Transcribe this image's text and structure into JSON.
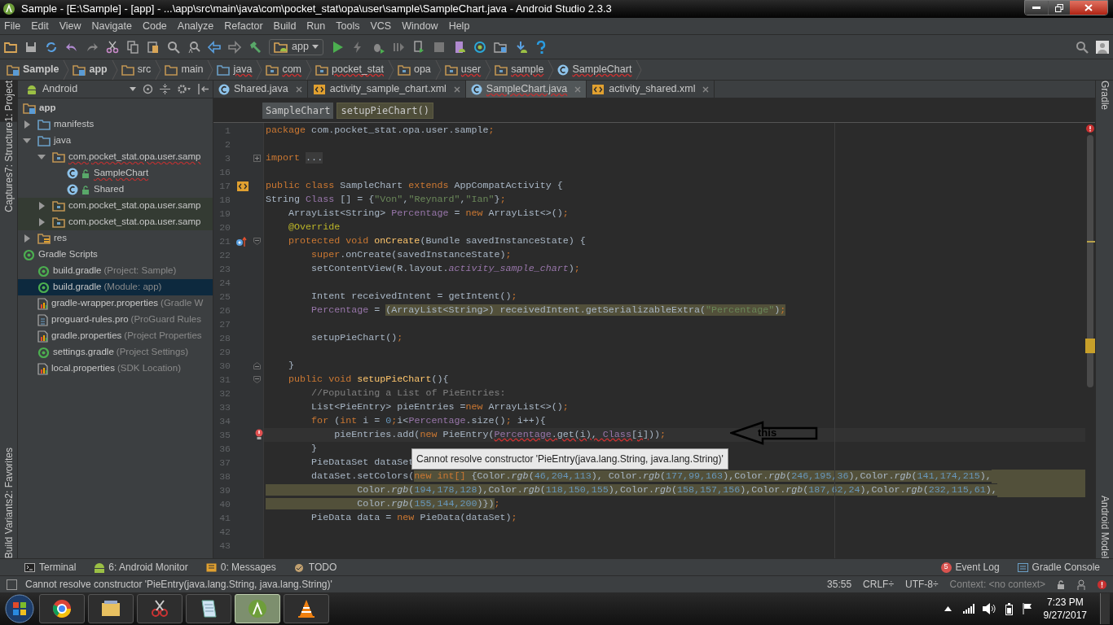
{
  "window": {
    "title": "Sample - [E:\\Sample] - [app] - ...\\app\\src\\main\\java\\com\\pocket_stat\\opa\\user\\sample\\SampleChart.java - Android Studio 2.3.3"
  },
  "menu": [
    "File",
    "Edit",
    "View",
    "Navigate",
    "Code",
    "Analyze",
    "Refactor",
    "Build",
    "Run",
    "Tools",
    "VCS",
    "Window",
    "Help"
  ],
  "run_config": "app",
  "breadcrumbs": [
    {
      "label": "Sample",
      "kind": "module",
      "bold": true,
      "error": false
    },
    {
      "label": "app",
      "kind": "module",
      "bold": true,
      "error": false
    },
    {
      "label": "src",
      "kind": "folder",
      "bold": false,
      "error": false
    },
    {
      "label": "main",
      "kind": "folder",
      "bold": false,
      "error": false
    },
    {
      "label": "java",
      "kind": "source",
      "bold": false,
      "error": true
    },
    {
      "label": "com",
      "kind": "package",
      "bold": false,
      "error": true
    },
    {
      "label": "pocket_stat",
      "kind": "package",
      "bold": false,
      "error": true
    },
    {
      "label": "opa",
      "kind": "package",
      "bold": false,
      "error": false
    },
    {
      "label": "user",
      "kind": "package",
      "bold": false,
      "error": true
    },
    {
      "label": "sample",
      "kind": "package",
      "bold": false,
      "error": true
    },
    {
      "label": "SampleChart",
      "kind": "class",
      "bold": false,
      "error": true
    }
  ],
  "left_strip": {
    "top": [
      {
        "label": "1: Project",
        "selected": true
      },
      {
        "label": "7: Structure",
        "selected": false
      },
      {
        "label": "Captures",
        "selected": false
      }
    ],
    "bottom": [
      {
        "label": "2: Favorites",
        "selected": false
      },
      {
        "label": "Build Variants",
        "selected": false
      }
    ]
  },
  "right_strip": {
    "top": [
      {
        "label": "Gradle"
      }
    ],
    "bottom": [
      {
        "label": "Android Model"
      }
    ]
  },
  "project": {
    "view": "Android",
    "tree": [
      {
        "label": "app",
        "kind": "module",
        "children": [
          {
            "label": "manifests",
            "kind": "source",
            "expanded": false
          },
          {
            "label": "java",
            "kind": "source",
            "expanded": true,
            "children": [
              {
                "label": "com.pocket_stat.opa.user.samp",
                "kind": "package",
                "expanded": true,
                "error": true,
                "children": [
                  {
                    "label": "SampleChart",
                    "kind": "class",
                    "error": true
                  },
                  {
                    "label": "Shared",
                    "kind": "class",
                    "error": false
                  }
                ]
              },
              {
                "label": "com.pocket_stat.opa.user.samp",
                "kind": "package",
                "expanded": false,
                "tinted": true
              },
              {
                "label": "com.pocket_stat.opa.user.samp",
                "kind": "package",
                "expanded": false,
                "tinted": true
              }
            ]
          },
          {
            "label": "res",
            "kind": "res",
            "expanded": false
          }
        ]
      },
      {
        "label": "Gradle Scripts",
        "kind": "gradle",
        "children": [
          {
            "label": "build.gradle",
            "note": "(Project: Sample)",
            "kind": "gradle",
            "selected": false
          },
          {
            "label": "build.gradle",
            "note": "(Module: app)",
            "kind": "gradle",
            "selected": true
          },
          {
            "label": "gradle-wrapper.properties",
            "note": "(Gradle W",
            "kind": "props",
            "selected": false
          },
          {
            "label": "proguard-rules.pro",
            "note": "(ProGuard Rules",
            "kind": "file",
            "selected": false
          },
          {
            "label": "gradle.properties",
            "note": "(Project Properties",
            "kind": "props",
            "selected": false
          },
          {
            "label": "settings.gradle",
            "note": "(Project Settings)",
            "kind": "gradle",
            "selected": false
          },
          {
            "label": "local.properties",
            "note": "(SDK Location)",
            "kind": "props",
            "selected": false
          }
        ]
      }
    ]
  },
  "tabs": [
    {
      "label": "Shared.java",
      "kind": "class",
      "selected": false,
      "error": false
    },
    {
      "label": "activity_sample_chart.xml",
      "kind": "xml",
      "selected": false,
      "error": false
    },
    {
      "label": "SampleChart.java",
      "kind": "class",
      "selected": true,
      "error": true
    },
    {
      "label": "activity_shared.xml",
      "kind": "xml",
      "selected": false,
      "error": false
    }
  ],
  "editor_breadcrumbs": [
    {
      "label": "SampleChart",
      "selected": false
    },
    {
      "label": "setupPieChart()",
      "selected": true
    }
  ],
  "code": [
    {
      "number": "1",
      "tokens": [
        {
          "kind": "kw",
          "text": "package"
        },
        {
          "kind": "plain",
          "text": " com.pocket_stat.opa.user.sample"
        },
        {
          "kind": "kw",
          "text": ";"
        }
      ]
    },
    {
      "number": "2"
    },
    {
      "number": "3",
      "gutter": [
        {
          "kind": "fold_plus"
        }
      ],
      "tokens": [
        {
          "kind": "kw",
          "text": "import "
        },
        {
          "kind": "folded",
          "text": "..."
        }
      ]
    },
    {
      "number": "16"
    },
    {
      "number": "17",
      "gutter": [
        {
          "kind": "layout"
        }
      ],
      "tokens": [
        {
          "kind": "kw",
          "text": "public class"
        },
        {
          "kind": "plain",
          "text": " SampleChart "
        },
        {
          "kind": "kw",
          "text": "extends"
        },
        {
          "kind": "plain",
          "text": " AppCompatActivity {"
        }
      ]
    },
    {
      "number": "18",
      "tokens": [
        {
          "kind": "plain",
          "text": "String "
        },
        {
          "kind": "field",
          "text": "Class"
        },
        {
          "kind": "plain",
          "text": " [] = {"
        },
        {
          "kind": "str",
          "text": "\"Von\""
        },
        {
          "kind": "plain",
          "text": ","
        },
        {
          "kind": "str",
          "text": "\"Reynard\""
        },
        {
          "kind": "plain",
          "text": ","
        },
        {
          "kind": "str",
          "text": "\"Ian\""
        },
        {
          "kind": "plain",
          "text": "}"
        },
        {
          "kind": "kw",
          "text": ";"
        }
      ]
    },
    {
      "number": "19",
      "tokens": [
        {
          "kind": "plain",
          "text": "    ArrayList<String> "
        },
        {
          "kind": "field",
          "text": "Percentage"
        },
        {
          "kind": "plain",
          "text": " = "
        },
        {
          "kind": "kw",
          "text": "new"
        },
        {
          "kind": "plain",
          "text": " ArrayList<>()"
        },
        {
          "kind": "kw",
          "text": ";"
        }
      ]
    },
    {
      "number": "20",
      "tokens": [
        {
          "kind": "ann",
          "text": "    @Override"
        }
      ]
    },
    {
      "number": "21",
      "gutter": [
        {
          "kind": "override"
        },
        {
          "kind": "fold_start"
        }
      ],
      "tokens": [
        {
          "kind": "kw",
          "text": "    protected void "
        },
        {
          "kind": "method",
          "text": "onCreate"
        },
        {
          "kind": "plain",
          "text": "(Bundle savedInstanceState) {"
        }
      ]
    },
    {
      "number": "22",
      "tokens": [
        {
          "kind": "kw",
          "text": "        super"
        },
        {
          "kind": "plain",
          "text": ".onCreate(savedInstanceState)"
        },
        {
          "kind": "kw",
          "text": ";"
        }
      ]
    },
    {
      "number": "23",
      "tokens": [
        {
          "kind": "plain",
          "text": "        setContentView(R.layout."
        },
        {
          "kind": "field_italic",
          "text": "activity_sample_chart"
        },
        {
          "kind": "plain",
          "text": ")"
        },
        {
          "kind": "kw",
          "text": ";"
        }
      ]
    },
    {
      "number": "24"
    },
    {
      "number": "25",
      "tokens": [
        {
          "kind": "plain",
          "text": "        Intent receivedIntent = getIntent()"
        },
        {
          "kind": "kw",
          "text": ";"
        }
      ]
    },
    {
      "number": "26",
      "tokens": [
        {
          "kind": "field",
          "text": "        Percentage"
        },
        {
          "kind": "plain",
          "text": " = "
        },
        {
          "kind": "plain",
          "text": "(ArrayList<String>) receivedIntent.getSerializableExtra(",
          "highlighted": true
        },
        {
          "kind": "str",
          "text": "\"Percentage\"",
          "highlighted": true
        },
        {
          "kind": "plain",
          "text": ")",
          "highlighted": true
        },
        {
          "kind": "kw",
          "text": ";",
          "highlighted": true
        }
      ]
    },
    {
      "number": "27"
    },
    {
      "number": "28",
      "tokens": [
        {
          "kind": "plain",
          "text": "        setupPieChart()"
        },
        {
          "kind": "kw",
          "text": ";"
        }
      ]
    },
    {
      "number": "29"
    },
    {
      "number": "30",
      "gutter": [
        {
          "kind": "fold_end"
        }
      ],
      "tokens": [
        {
          "kind": "plain",
          "text": "    }"
        }
      ]
    },
    {
      "number": "31",
      "gutter": [
        {
          "kind": "fold_start"
        }
      ],
      "tokens": [
        {
          "kind": "kw",
          "text": "    public void "
        },
        {
          "kind": "method",
          "text": "setupPieChart"
        },
        {
          "kind": "plain",
          "text": "(){"
        }
      ]
    },
    {
      "number": "32",
      "tokens": [
        {
          "kind": "comment",
          "text": "        //Populating a List of PieEntries:"
        }
      ]
    },
    {
      "number": "33",
      "tokens": [
        {
          "kind": "plain",
          "text": "        List<PieEntry> pieEntries ="
        },
        {
          "kind": "kw",
          "text": "new"
        },
        {
          "kind": "plain",
          "text": " ArrayList<>()"
        },
        {
          "kind": "kw",
          "text": ";"
        }
      ]
    },
    {
      "number": "34",
      "tokens": [
        {
          "kind": "kw",
          "text": "        for"
        },
        {
          "kind": "plain",
          "text": " ("
        },
        {
          "kind": "kw",
          "text": "int"
        },
        {
          "kind": "plain",
          "text": " i = "
        },
        {
          "kind": "num",
          "text": "0"
        },
        {
          "kind": "kw",
          "text": ";"
        },
        {
          "kind": "plain",
          "text": "i<"
        },
        {
          "kind": "field",
          "text": "Percentage"
        },
        {
          "kind": "plain",
          "text": ".size()"
        },
        {
          "kind": "kw",
          "text": ";"
        },
        {
          "kind": "plain",
          "text": " i++){"
        }
      ]
    },
    {
      "number": "35",
      "current": true,
      "gutter": [
        {
          "kind": "error"
        }
      ],
      "tokens": [
        {
          "kind": "plain",
          "text": "            pieEntries.add("
        },
        {
          "kind": "kw",
          "text": "new"
        },
        {
          "kind": "plain",
          "text": " PieEntry("
        },
        {
          "kind": "field",
          "text": "Percentage",
          "error": true
        },
        {
          "kind": "plain",
          "text": ".get(i), ",
          "error": true
        },
        {
          "kind": "field",
          "text": "Class",
          "error": true
        },
        {
          "kind": "plain",
          "text": "[i]",
          "error": true
        },
        {
          "kind": "plain",
          "text": "))"
        },
        {
          "kind": "kw",
          "text": ";"
        }
      ]
    },
    {
      "number": "36",
      "tokens": [
        {
          "kind": "plain",
          "text": "        }"
        }
      ]
    },
    {
      "number": "37",
      "tokens": [
        {
          "kind": "plain",
          "text": "        PieDataSet dataSet"
        }
      ]
    },
    {
      "number": "38",
      "fill_rest": true,
      "tokens": [
        {
          "kind": "plain",
          "text": "        dataSet.setColors("
        },
        {
          "kind": "kw",
          "text": "new int[]",
          "highlighted": true
        },
        {
          "kind": "plain",
          "text": " {Color.",
          "highlighted": true
        },
        {
          "kind": "static",
          "text": "rgb",
          "highlighted": true
        },
        {
          "kind": "plain",
          "text": "(",
          "highlighted": true
        },
        {
          "kind": "num",
          "text": "46,204,113",
          "highlighted": true
        },
        {
          "kind": "plain",
          "text": "), Color.",
          "highlighted": true
        },
        {
          "kind": "static",
          "text": "rgb",
          "highlighted": true
        },
        {
          "kind": "plain",
          "text": "(",
          "highlighted": true
        },
        {
          "kind": "num",
          "text": "177,99,163",
          "highlighted": true
        },
        {
          "kind": "plain",
          "text": "),Color.",
          "highlighted": true
        },
        {
          "kind": "static",
          "text": "rgb",
          "highlighted": true
        },
        {
          "kind": "plain",
          "text": "(",
          "highlighted": true
        },
        {
          "kind": "num",
          "text": "246,195,36",
          "highlighted": true
        },
        {
          "kind": "plain",
          "text": "),Color.",
          "highlighted": true
        },
        {
          "kind": "static",
          "text": "rgb",
          "highlighted": true
        },
        {
          "kind": "plain",
          "text": "(",
          "highlighted": true
        },
        {
          "kind": "num",
          "text": "141,174,215",
          "highlighted": true
        },
        {
          "kind": "plain",
          "text": "),",
          "highlighted": true
        }
      ]
    },
    {
      "number": "39",
      "fill_rest": true,
      "tokens": [
        {
          "kind": "plain",
          "text": "                Color.",
          "highlighted": true
        },
        {
          "kind": "static",
          "text": "rgb",
          "highlighted": true
        },
        {
          "kind": "plain",
          "text": "(",
          "highlighted": true
        },
        {
          "kind": "num",
          "text": "194,178,128",
          "highlighted": true
        },
        {
          "kind": "plain",
          "text": "),Color.",
          "highlighted": true
        },
        {
          "kind": "static",
          "text": "rgb",
          "highlighted": true
        },
        {
          "kind": "plain",
          "text": "(",
          "highlighted": true
        },
        {
          "kind": "num",
          "text": "118,150,155",
          "highlighted": true
        },
        {
          "kind": "plain",
          "text": "),Color.",
          "highlighted": true
        },
        {
          "kind": "static",
          "text": "rgb",
          "highlighted": true
        },
        {
          "kind": "plain",
          "text": "(",
          "highlighted": true
        },
        {
          "kind": "num",
          "text": "158,157,156",
          "highlighted": true
        },
        {
          "kind": "plain",
          "text": "),Color.",
          "highlighted": true
        },
        {
          "kind": "static",
          "text": "rgb",
          "highlighted": true
        },
        {
          "kind": "plain",
          "text": "(",
          "highlighted": true
        },
        {
          "kind": "num",
          "text": "187,62,24",
          "highlighted": true
        },
        {
          "kind": "plain",
          "text": "),Color.",
          "highlighted": true
        },
        {
          "kind": "static",
          "text": "rgb",
          "highlighted": true
        },
        {
          "kind": "plain",
          "text": "(",
          "highlighted": true
        },
        {
          "kind": "num",
          "text": "232,115,61",
          "highlighted": true
        },
        {
          "kind": "plain",
          "text": "),",
          "highlighted": true
        }
      ]
    },
    {
      "number": "40",
      "tokens": [
        {
          "kind": "plain",
          "text": "                Color.",
          "highlighted": true
        },
        {
          "kind": "static",
          "text": "rgb",
          "highlighted": true
        },
        {
          "kind": "plain",
          "text": "(",
          "highlighted": true
        },
        {
          "kind": "num",
          "text": "155,144,200",
          "highlighted": true
        },
        {
          "kind": "plain",
          "text": ")})",
          "highlighted": true
        },
        {
          "kind": "kw",
          "text": ";"
        }
      ]
    },
    {
      "number": "41",
      "tokens": [
        {
          "kind": "plain",
          "text": "        PieData data = "
        },
        {
          "kind": "kw",
          "text": "new"
        },
        {
          "kind": "plain",
          "text": " PieData(dataSet)"
        },
        {
          "kind": "kw",
          "text": ";"
        }
      ]
    },
    {
      "number": "42"
    },
    {
      "number": "43"
    }
  ],
  "tooltip": "Cannot resolve constructor 'PieEntry(java.lang.String, java.lang.String)'",
  "annotation": "this",
  "tool_buttons": {
    "left": [
      {
        "label": "Terminal",
        "kind": "terminal"
      },
      {
        "label": "6: Android Monitor",
        "kind": "android"
      },
      {
        "label": "0: Messages",
        "kind": "messages"
      },
      {
        "label": "TODO",
        "kind": "todo"
      }
    ],
    "right": [
      {
        "label": "Event Log",
        "kind": "log",
        "badge": "5"
      },
      {
        "label": "Gradle Console",
        "kind": "console"
      }
    ]
  },
  "status_bar": {
    "message": "Cannot resolve constructor 'PieEntry(java.lang.String, java.lang.String)'",
    "position": "35:55",
    "line_separator": "CRLF÷",
    "encoding": "UTF-8÷",
    "context": "Context: <no context>"
  },
  "taskbar": {
    "time": "7:23 PM",
    "date": "9/27/2017"
  }
}
